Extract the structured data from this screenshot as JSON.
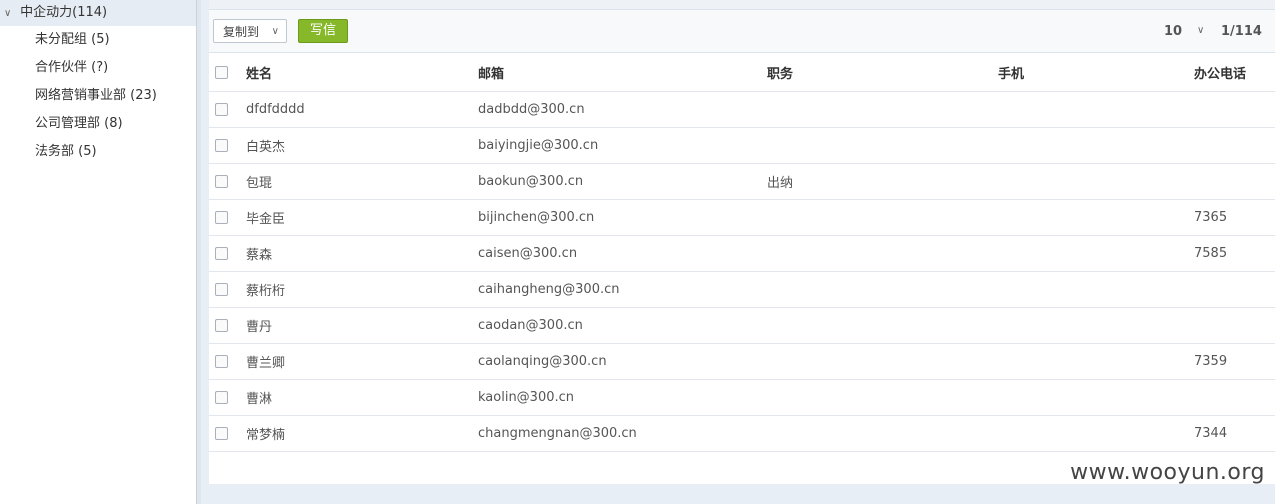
{
  "sidebar": {
    "root_label": "中企动力(114)",
    "items": [
      {
        "label": "未分配组 (5)"
      },
      {
        "label": "合作伙伴 (?)"
      },
      {
        "label": "网络营销事业部 (23)"
      },
      {
        "label": "公司管理部 (8)"
      },
      {
        "label": "法务部 (5)"
      }
    ]
  },
  "toolbar": {
    "copy_label": "复制到",
    "write_label": "写信"
  },
  "pager": {
    "page_size": "10",
    "page_info": "1/114"
  },
  "table": {
    "headers": {
      "name": "姓名",
      "email": "邮箱",
      "position": "职务",
      "mobile": "手机",
      "office_phone": "办公电话"
    },
    "rows": [
      {
        "name": "dfdfdddd",
        "email": "dadbdd@300.cn",
        "position": "",
        "mobile": "",
        "office": ""
      },
      {
        "name": "白英杰",
        "email": "baiyingjie@300.cn",
        "position": "",
        "mobile": "",
        "office": ""
      },
      {
        "name": "包琨",
        "email": "baokun@300.cn",
        "position": "出纳",
        "mobile": "",
        "office": ""
      },
      {
        "name": "毕金臣",
        "email": "bijinchen@300.cn",
        "position": "",
        "mobile": "",
        "office": "7365"
      },
      {
        "name": "蔡森",
        "email": "caisen@300.cn",
        "position": "",
        "mobile": "",
        "office": "7585"
      },
      {
        "name": "蔡桁桁",
        "email": "caihangheng@300.cn",
        "position": "",
        "mobile": "",
        "office": ""
      },
      {
        "name": "曹丹",
        "email": "caodan@300.cn",
        "position": "",
        "mobile": "",
        "office": ""
      },
      {
        "name": "曹兰卿",
        "email": "caolanqing@300.cn",
        "position": "",
        "mobile": "",
        "office": "7359"
      },
      {
        "name": "曹淋",
        "email": "kaolin@300.cn",
        "position": "",
        "mobile": "",
        "office": ""
      },
      {
        "name": "常梦楠",
        "email": "changmengnan@300.cn",
        "position": "",
        "mobile": "",
        "office": "7344"
      }
    ]
  },
  "watermark": "www.wooyun.org"
}
